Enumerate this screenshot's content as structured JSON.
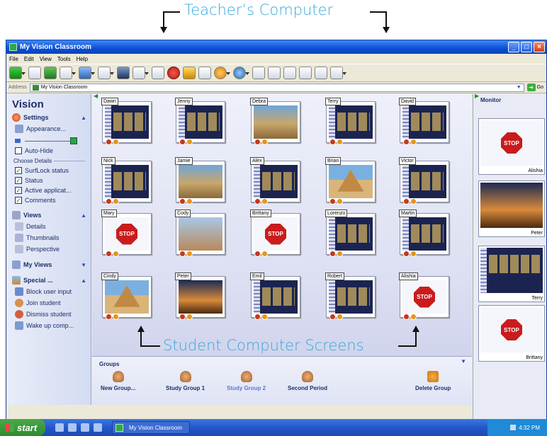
{
  "annotations": {
    "teacher": "Teacher’s Computer",
    "students": "Student Computer Screens"
  },
  "window": {
    "title": "My Vision Classroom",
    "buttons": [
      "_",
      "□",
      "×"
    ]
  },
  "menu": [
    "File",
    "Edit",
    "View",
    "Tools",
    "Help"
  ],
  "address": {
    "label": "Address",
    "value": "My Vision Classroom",
    "go": "Go"
  },
  "sidebar": {
    "title": "Vision",
    "settings": {
      "label": "Settings",
      "appearance": "Appearance...",
      "autohide": "Auto-Hide",
      "choose_details": "Choose Details",
      "details": [
        {
          "label": "SurfLock status",
          "checked": true
        },
        {
          "label": "Status",
          "checked": true
        },
        {
          "label": "Active applicat...",
          "checked": true
        },
        {
          "label": "Comments",
          "checked": true
        }
      ]
    },
    "views": {
      "label": "Views",
      "items": [
        "Details",
        "Thumbnails",
        "Perspective"
      ]
    },
    "my_views": "My Views",
    "special": {
      "label": "Special ...",
      "items": [
        "Block user input",
        "Join student",
        "Dismiss student",
        "Wake up comp..."
      ]
    }
  },
  "students": [
    {
      "name": "Dawn",
      "screen": "page"
    },
    {
      "name": "Jenny",
      "screen": "page"
    },
    {
      "name": "Debra",
      "screen": "sphinx"
    },
    {
      "name": "Terry",
      "screen": "page"
    },
    {
      "name": "David",
      "screen": "page"
    },
    {
      "name": "Nick",
      "screen": "page"
    },
    {
      "name": "Jamie",
      "screen": "sphinx"
    },
    {
      "name": "Alex",
      "screen": "page"
    },
    {
      "name": "Brian",
      "screen": "pyramid"
    },
    {
      "name": "Victor",
      "screen": "page"
    },
    {
      "name": "Mary",
      "screen": "stop"
    },
    {
      "name": "Cody",
      "screen": "group"
    },
    {
      "name": "Brittany",
      "screen": "stop"
    },
    {
      "name": "Lorenzo",
      "screen": "page"
    },
    {
      "name": "Martin",
      "screen": "page"
    },
    {
      "name": "Cindy",
      "screen": "pyramid"
    },
    {
      "name": "Peter",
      "screen": "sunset"
    },
    {
      "name": "Emil",
      "screen": "page"
    },
    {
      "name": "Robert",
      "screen": "page"
    },
    {
      "name": "Alishia",
      "screen": "stop"
    }
  ],
  "stop_text": "STOP",
  "groups": {
    "title": "Groups",
    "items": [
      {
        "label": "New Group...",
        "selected": false
      },
      {
        "label": "Study Group 1",
        "selected": false
      },
      {
        "label": "Study Group 2",
        "selected": true
      },
      {
        "label": "Second Period",
        "selected": false
      }
    ],
    "delete": "Delete Group"
  },
  "monitor": {
    "title": "Monitor",
    "items": [
      {
        "name": "Alishia",
        "screen": "stop"
      },
      {
        "name": "Peter",
        "screen": "sunset"
      },
      {
        "name": "Terry",
        "screen": "page"
      },
      {
        "name": "Brittany",
        "screen": "stop"
      }
    ]
  },
  "taskbar": {
    "start": "start",
    "task": "My Vision Classroom",
    "clock": "4:32 PM"
  }
}
